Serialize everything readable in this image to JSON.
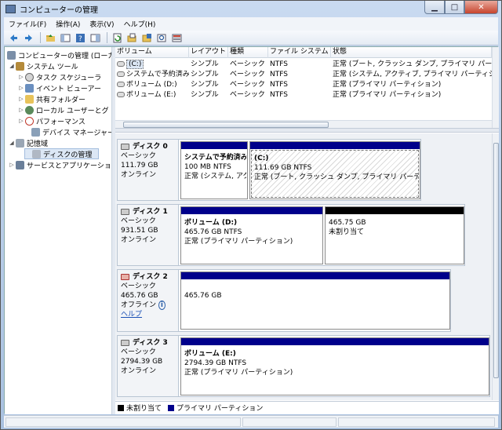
{
  "window": {
    "title": "コンピューターの管理"
  },
  "menu": [
    "ファイル(F)",
    "操作(A)",
    "表示(V)",
    "ヘルプ(H)"
  ],
  "toolbar_icons": [
    "back-arrow-icon",
    "forward-arrow-icon",
    "up-folder-icon",
    "show-hide-tree-icon",
    "help-icon",
    "console-icon",
    "refresh-icon",
    "open-icon",
    "properties-icon",
    "search-icon",
    "export-icon"
  ],
  "tree": {
    "root": "コンピューターの管理 (ローカ",
    "system_tools": "システム ツール",
    "task_scheduler": "タスク スケジューラ",
    "event_viewer": "イベント ビューアー",
    "shared_folders": "共有フォルダー",
    "local_users": "ローカル ユーザーとグ",
    "performance": "パフォーマンス",
    "device_manager": "デバイス マネージャー",
    "storage": "記憶域",
    "disk_management": "ディスクの管理",
    "services_apps": "サービスとアプリケーショ"
  },
  "volume_list": {
    "headers": [
      "ボリューム",
      "レイアウト",
      "種類",
      "ファイル システム",
      "状態"
    ],
    "rows": [
      {
        "volume": "(C:)",
        "layout": "シンプル",
        "type": "ベーシック",
        "fs": "NTFS",
        "status": "正常 (ブート, クラッシュ ダンプ, プライマリ パーティション)"
      },
      {
        "volume": "システムで予約済み",
        "layout": "シンプル",
        "type": "ベーシック",
        "fs": "NTFS",
        "status": "正常 (システム, アクティブ, プライマリ パーティション)"
      },
      {
        "volume": "ボリューム (D:)",
        "layout": "シンプル",
        "type": "ベーシック",
        "fs": "NTFS",
        "status": "正常 (プライマリ パーティション)"
      },
      {
        "volume": "ボリューム (E:)",
        "layout": "シンプル",
        "type": "ベーシック",
        "fs": "NTFS",
        "status": "正常 (プライマリ パーティション)"
      }
    ]
  },
  "disks": [
    {
      "name": "ディスク 0",
      "type": "ベーシック",
      "size": "111.79 GB",
      "state": "オンライン",
      "partitions": [
        {
          "name": "システムで予約済み",
          "size": "100 MB NTFS",
          "status": "正常 (システム, アク"
        },
        {
          "name": "(C:)",
          "size": "111.69 GB NTFS",
          "status": "正常 (ブート, クラッシュ ダンプ, プライマリ パーティ"
        }
      ]
    },
    {
      "name": "ディスク 1",
      "type": "ベーシック",
      "size": "931.51 GB",
      "state": "オンライン",
      "partitions": [
        {
          "name": "ボリューム (D:)",
          "size": "465.76 GB NTFS",
          "status": "正常 (プライマリ パーティション)"
        },
        {
          "name": "",
          "size": "465.75 GB",
          "status": "未割り当て"
        }
      ]
    },
    {
      "name": "ディスク 2",
      "type": "ベーシック",
      "size": "465.76 GB",
      "state": "オフライン",
      "help": "ヘルプ",
      "partitions": [
        {
          "name": "",
          "size": "465.76 GB",
          "status": ""
        }
      ]
    },
    {
      "name": "ディスク 3",
      "type": "ベーシック",
      "size": "2794.39 GB",
      "state": "オンライン",
      "partitions": [
        {
          "name": "ボリューム (E:)",
          "size": "2794.39 GB NTFS",
          "status": "正常 (プライマリ パーティション)"
        }
      ]
    }
  ],
  "legend": {
    "unallocated": "未割り当て",
    "primary": "プライマリ パーティション"
  },
  "colors": {
    "primary": "#00008b",
    "unallocated": "#000000"
  }
}
